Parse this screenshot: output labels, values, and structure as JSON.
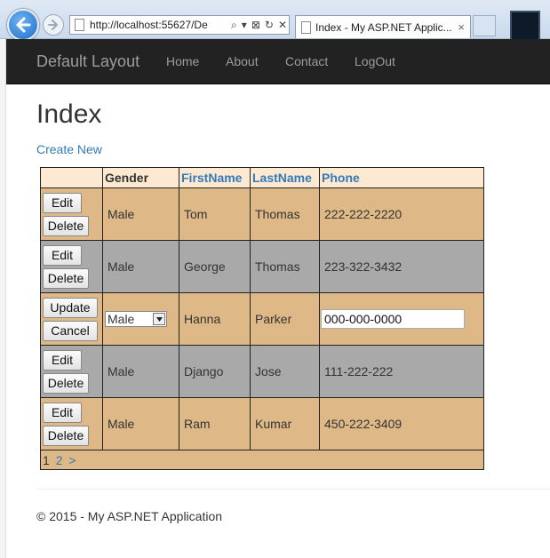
{
  "browser": {
    "address_url": "http://localhost:55627/De",
    "tab_title": "Index - My ASP.NET Applic...",
    "tab_close": "×",
    "addr_tools": [
      "⌕",
      "▾",
      "⊠",
      "↻",
      "✕"
    ]
  },
  "navbar": {
    "brand": "Default Layout",
    "links": [
      "Home",
      "About",
      "Contact",
      "LogOut"
    ]
  },
  "page": {
    "title": "Index",
    "create_new": "Create New"
  },
  "grid": {
    "headers": [
      "",
      "Gender",
      "FirstName",
      "LastName",
      "Phone"
    ],
    "rows": [
      {
        "gender": "Male",
        "first": "Tom",
        "last": "Thomas",
        "phone": "222-222-2220",
        "btn1": "Edit",
        "btn2": "Delete"
      },
      {
        "gender": "Male",
        "first": "George",
        "last": "Thomas",
        "phone": "223-322-3432",
        "btn1": "Edit",
        "btn2": "Delete"
      },
      {
        "gender": "Male",
        "first": "Hanna",
        "last": "Parker",
        "phone": "000-000-0000",
        "btn1": "Update",
        "btn2": "Cancel"
      },
      {
        "gender": "Male",
        "first": "Django",
        "last": "Jose",
        "phone": "111-222-222",
        "btn1": "Edit",
        "btn2": "Delete"
      },
      {
        "gender": "Male",
        "first": "Ram",
        "last": "Kumar",
        "phone": "450-222-3409",
        "btn1": "Edit",
        "btn2": "Delete"
      }
    ],
    "pager": {
      "current": "1",
      "page2": "2",
      "next": ">"
    }
  },
  "footer": {
    "text": "© 2015 - My ASP.NET Application"
  },
  "colors": {
    "row_tan": "#deb887",
    "row_gray": "#a9a9a9",
    "header_bg": "#fde9d2",
    "link": "#337ab7",
    "navbar": "#222222"
  }
}
